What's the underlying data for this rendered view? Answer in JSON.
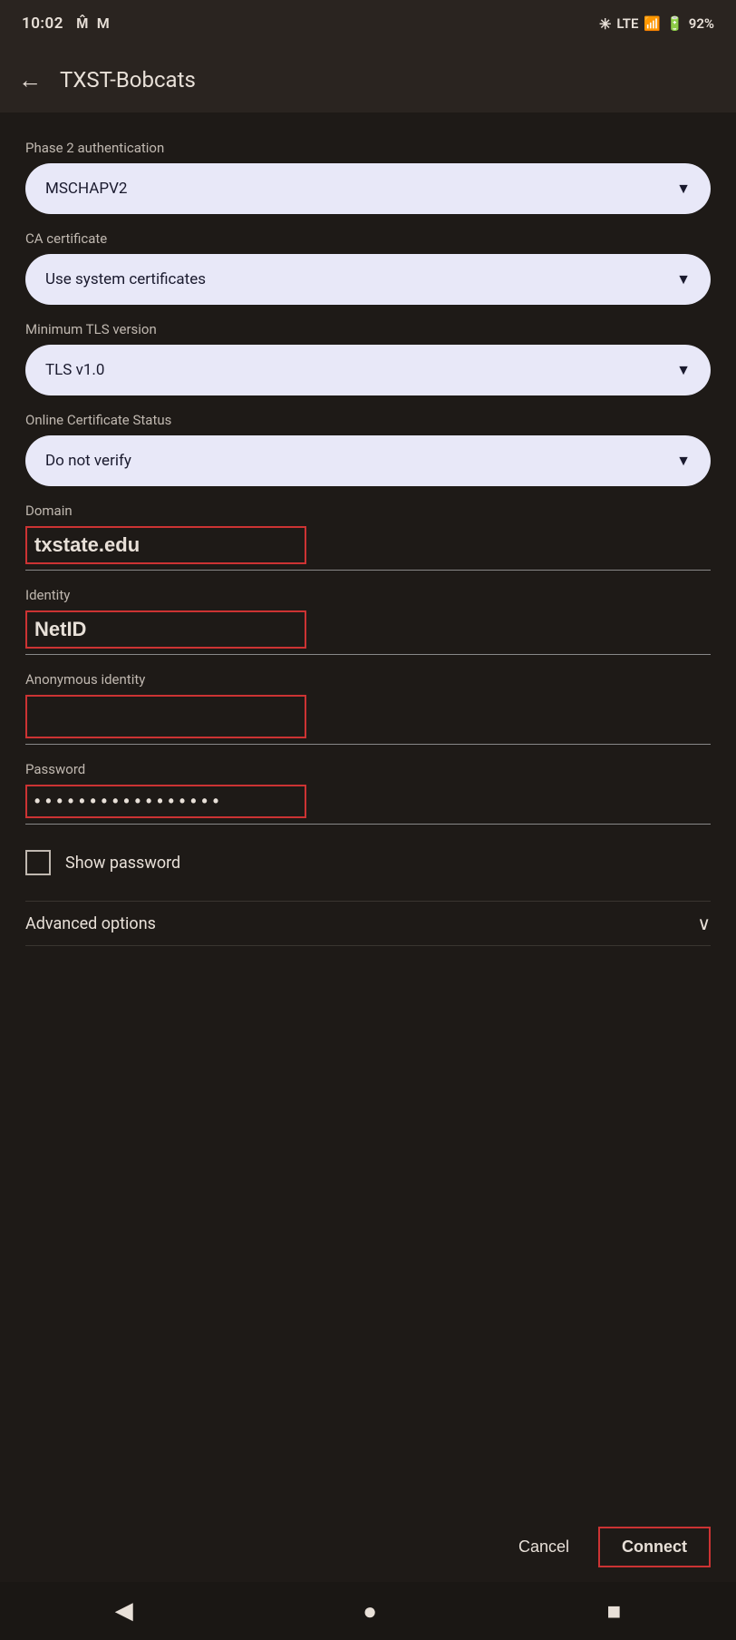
{
  "status_bar": {
    "time": "10:02",
    "mail_icon1": "M",
    "mail_icon2": "M",
    "bluetooth": "✳",
    "signal": "LTE",
    "battery": "92%"
  },
  "app_bar": {
    "back_label": "←",
    "title": "TXST-Bobcats"
  },
  "form": {
    "phase2_label": "Phase 2 authentication",
    "phase2_value": "MSCHAPV2",
    "ca_cert_label": "CA certificate",
    "ca_cert_value": "Use system certificates",
    "min_tls_label": "Minimum TLS version",
    "min_tls_value": "TLS v1.0",
    "ocsp_label": "Online Certificate Status",
    "ocsp_value": "Do not verify",
    "domain_label": "Domain",
    "domain_value": "txstate.edu",
    "identity_label": "Identity",
    "identity_value": "NetID",
    "anon_identity_label": "Anonymous identity",
    "anon_identity_value": "",
    "password_label": "Password",
    "password_value": "••••••••••••••••••",
    "show_password_label": "Show password",
    "advanced_options_label": "Advanced options"
  },
  "buttons": {
    "cancel_label": "Cancel",
    "connect_label": "Connect"
  },
  "nav": {
    "back_icon": "◀",
    "home_icon": "●",
    "recents_icon": "■"
  }
}
